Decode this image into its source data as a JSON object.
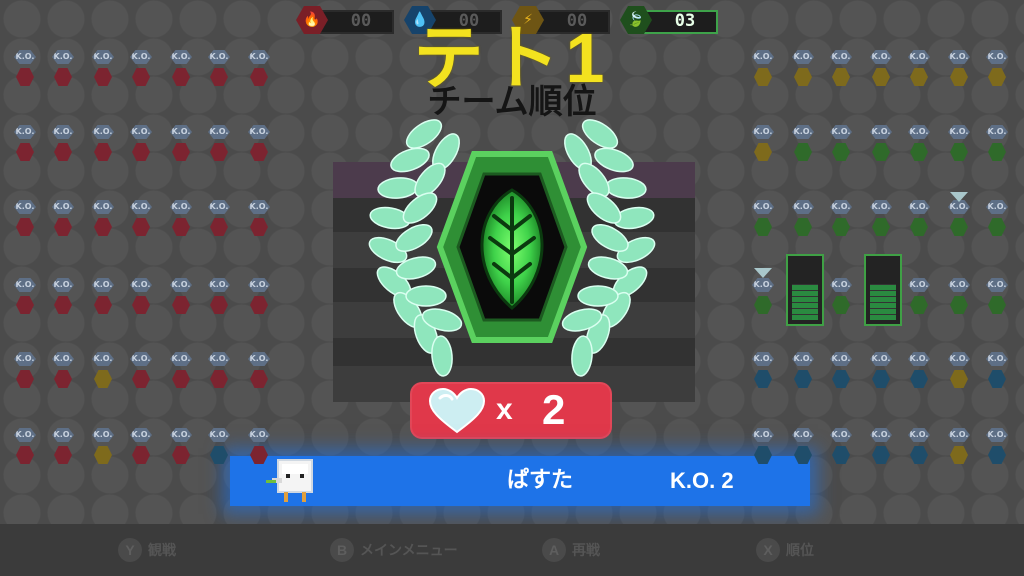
{
  "scoreboard": [
    {
      "team": "fire",
      "icon": "flame-icon",
      "value": "00",
      "color": "#d8333f",
      "active": false
    },
    {
      "team": "water",
      "icon": "droplet-icon",
      "value": "00",
      "color": "#1f8fe0",
      "active": false
    },
    {
      "team": "thunder",
      "icon": "lightning-icon",
      "value": "00",
      "color": "#e6b21e",
      "active": false
    },
    {
      "team": "grass",
      "icon": "leaf-icon",
      "value": "03",
      "color": "#3fb24a",
      "active": true
    }
  ],
  "result_title": "テト1",
  "rank_title": "チーム順位",
  "lives": {
    "times": "x",
    "count": "2"
  },
  "player": {
    "name": "ぱすた",
    "ko": "K.O. 2"
  },
  "grid_labels": {
    "ko": "K.O."
  },
  "bottom_menu": [
    {
      "button": "Y",
      "label": "観戦"
    },
    {
      "button": "B",
      "label": "メインメニュー"
    },
    {
      "button": "A",
      "label": "再戦"
    },
    {
      "button": "X",
      "label": "順位"
    }
  ],
  "colors": {
    "accent_yellow": "#f3e21f",
    "badge_red": "#e0384a",
    "player_bar_blue": "#1e73e8",
    "emblem_green": "#3fb24a",
    "laurel_mint": "#8fe6bd"
  }
}
